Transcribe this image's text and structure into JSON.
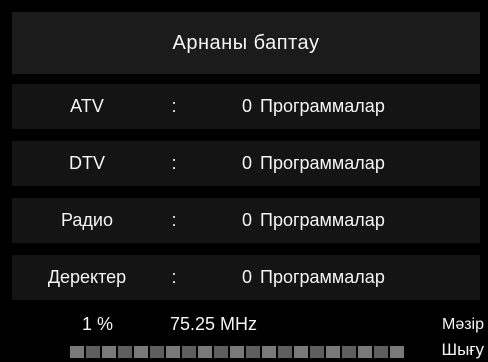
{
  "title": "Арнаны баптау",
  "rows": [
    {
      "label": "ATV",
      "colon": ":",
      "count": "0",
      "unit": "Программалар"
    },
    {
      "label": "DTV",
      "colon": ":",
      "count": "0",
      "unit": "Программалар"
    },
    {
      "label": "Радио",
      "colon": ":",
      "count": "0",
      "unit": "Программалар"
    },
    {
      "label": "Деректер",
      "colon": ":",
      "count": "0",
      "unit": "Программалар"
    }
  ],
  "status": {
    "percent": "1 %",
    "frequency": "75.25 MHz",
    "next_label": "Мәзір",
    "exit_label": "Шығу"
  },
  "progress": {
    "value_percent": 1
  },
  "colors": {
    "background": "#000000",
    "row_background": "#141414",
    "text": "#f5f5f5"
  }
}
